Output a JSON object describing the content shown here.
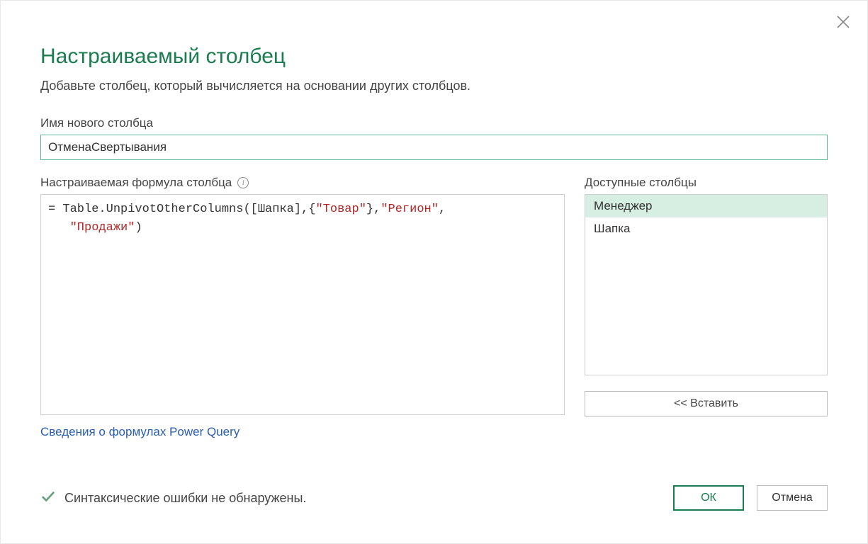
{
  "dialog": {
    "title": "Настраиваемый столбец",
    "subtitle": "Добавьте столбец, который вычисляется на основании других столбцов."
  },
  "newColumn": {
    "label": "Имя нового столбца",
    "value": "ОтменаСвертывания"
  },
  "formula": {
    "label": "Настраиваемая формула столбца",
    "prefix": "= ",
    "fn": "Table.UnpivotOtherColumns",
    "col": "Шапка",
    "str1": "\"Товар\"",
    "str2": "\"Регион\"",
    "str3": "\"Продажи\""
  },
  "available": {
    "label": "Доступные столбцы",
    "items": [
      "Менеджер",
      "Шапка"
    ],
    "selectedIndex": 0,
    "insertLabel": "<< Вставить"
  },
  "helpLink": "Сведения о формулах Power Query",
  "status": {
    "text": "Синтаксические ошибки не обнаружены."
  },
  "buttons": {
    "ok": "ОК",
    "cancel": "Отмена"
  }
}
